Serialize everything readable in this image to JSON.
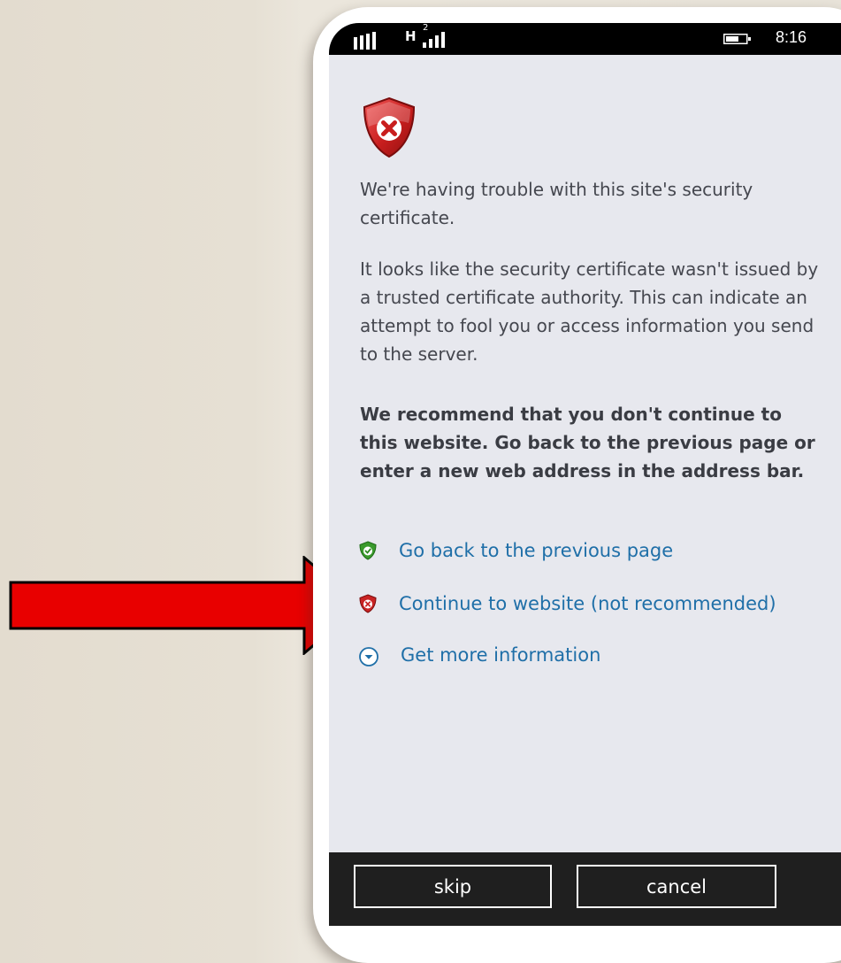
{
  "status_bar": {
    "network_type": "H",
    "sim_number": "2",
    "time": "8:16"
  },
  "error": {
    "icon": "shield-error-icon",
    "title": "We're having trouble with this site's security certificate.",
    "detail": "It looks like the security certificate wasn't issued by a trusted certificate authority. This can indicate an attempt to fool you or access information you send to the server.",
    "recommendation": "We recommend that you don't continue to this website. Go back to the previous page or enter a new web address in the address bar."
  },
  "links": [
    {
      "label": "Go back to the previous page",
      "icon": "green-shield-check-icon"
    },
    {
      "label": "Continue to website (not recommended)",
      "icon": "red-shield-x-icon"
    },
    {
      "label": "Get more information",
      "icon": "chevron-down-circle-icon"
    }
  ],
  "app_bar": {
    "skip_label": "skip",
    "cancel_label": "cancel"
  },
  "colors": {
    "annotation_arrow": "#e80000",
    "link": "#1f6fa8",
    "screen_background": "#e7e8ee"
  }
}
